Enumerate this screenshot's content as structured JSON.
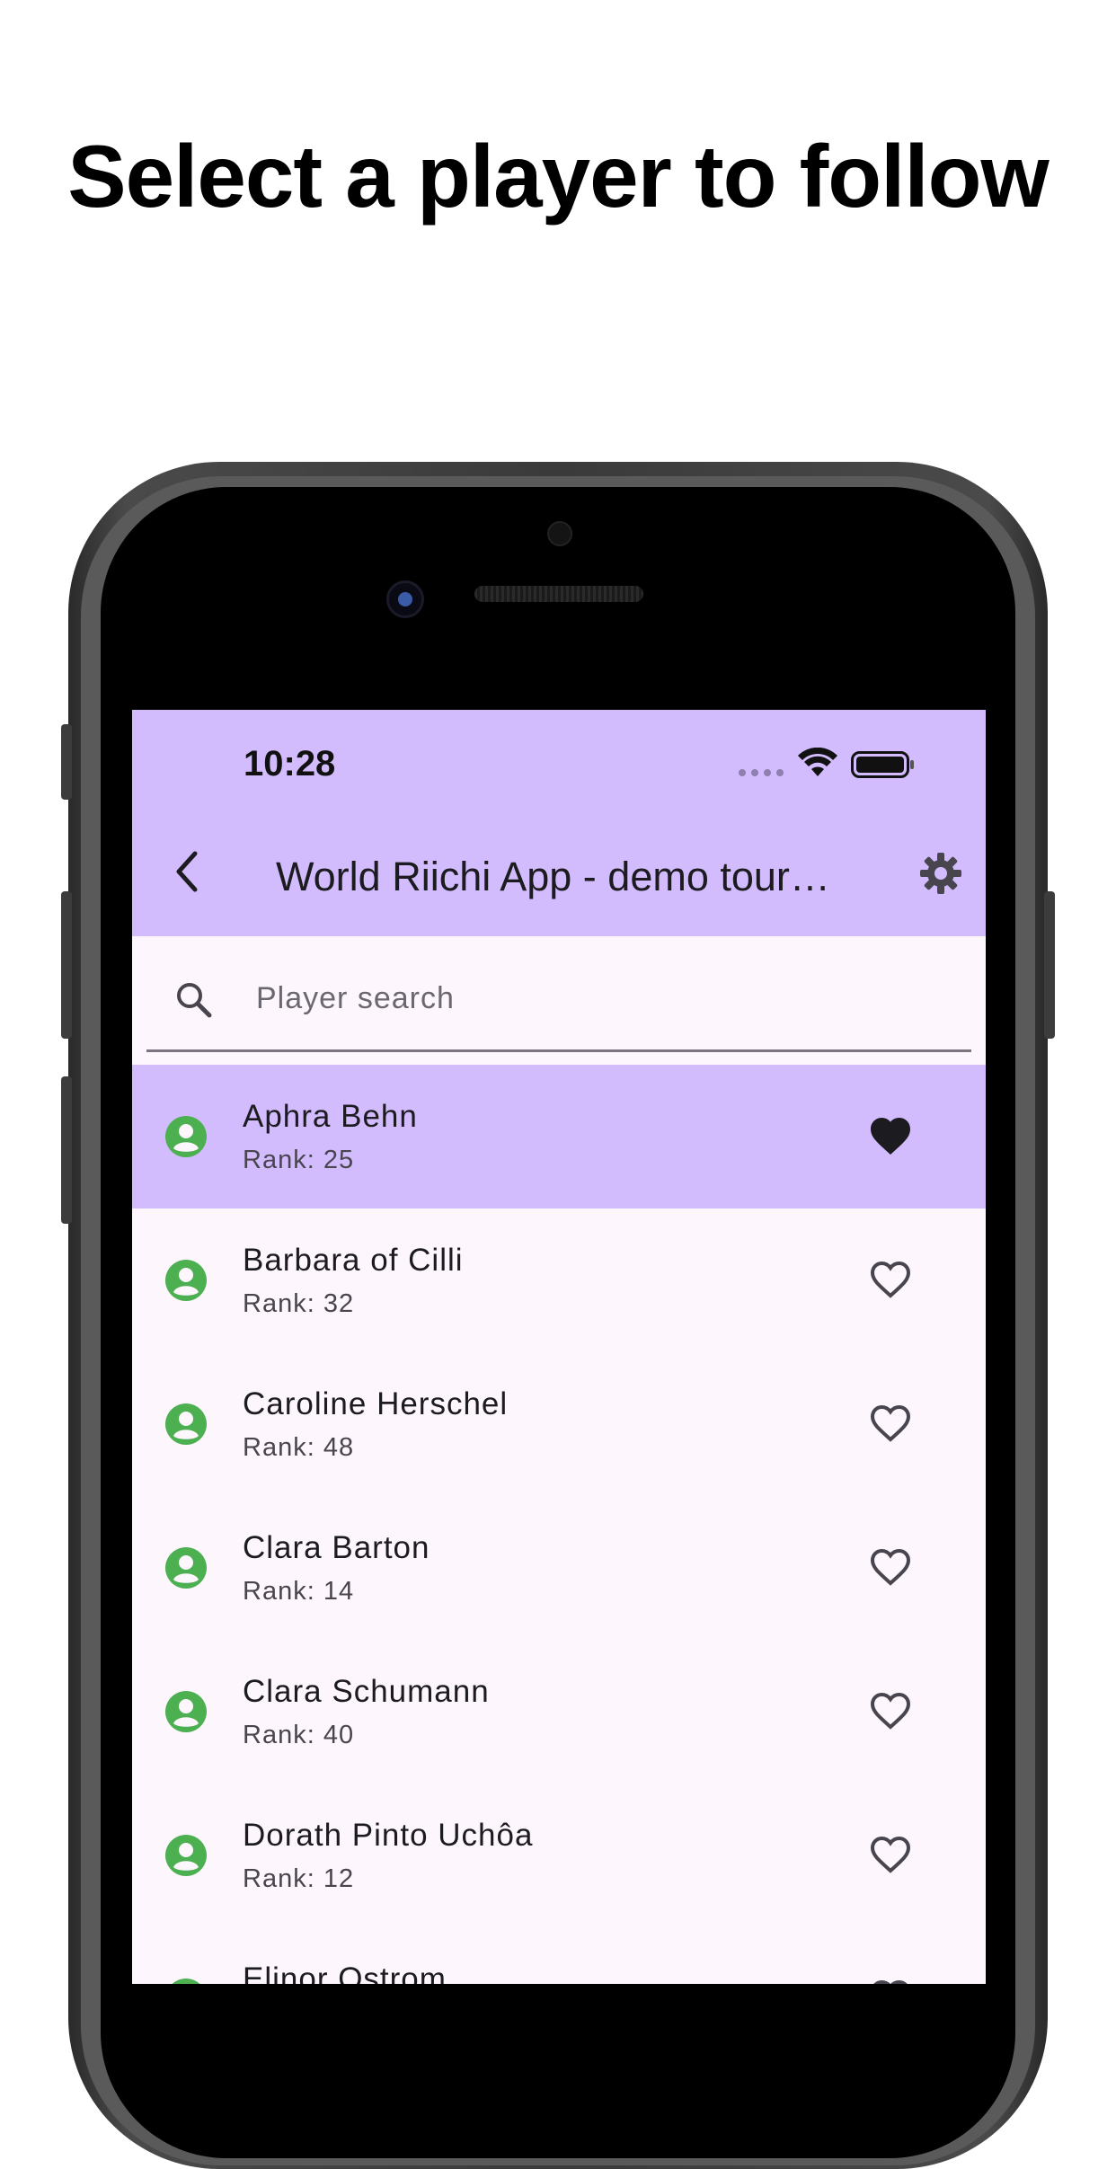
{
  "headline": "Select a player to follow",
  "status_bar": {
    "time": "10:28"
  },
  "app_bar": {
    "title": "World Riichi App - demo tournament",
    "back_icon": "chevron-left-icon",
    "settings_icon": "gear-icon"
  },
  "search": {
    "placeholder": "Player search",
    "value": "",
    "icon": "search-icon"
  },
  "colors": {
    "accent": "#d2bcfd",
    "avatar": "#4caf50",
    "background": "#fdf6fd"
  },
  "players": [
    {
      "name": "Aphra Behn",
      "rank": "Rank: 25",
      "favorite": true
    },
    {
      "name": "Barbara of Cilli",
      "rank": "Rank: 32",
      "favorite": false
    },
    {
      "name": "Caroline Herschel",
      "rank": "Rank: 48",
      "favorite": false
    },
    {
      "name": "Clara Barton",
      "rank": "Rank: 14",
      "favorite": false
    },
    {
      "name": "Clara Schumann",
      "rank": "Rank: 40",
      "favorite": false
    },
    {
      "name": "Dorath Pinto Uchôa",
      "rank": "Rank: 12",
      "favorite": false
    },
    {
      "name": "Elinor Ostrom",
      "rank": "",
      "favorite": false
    }
  ]
}
